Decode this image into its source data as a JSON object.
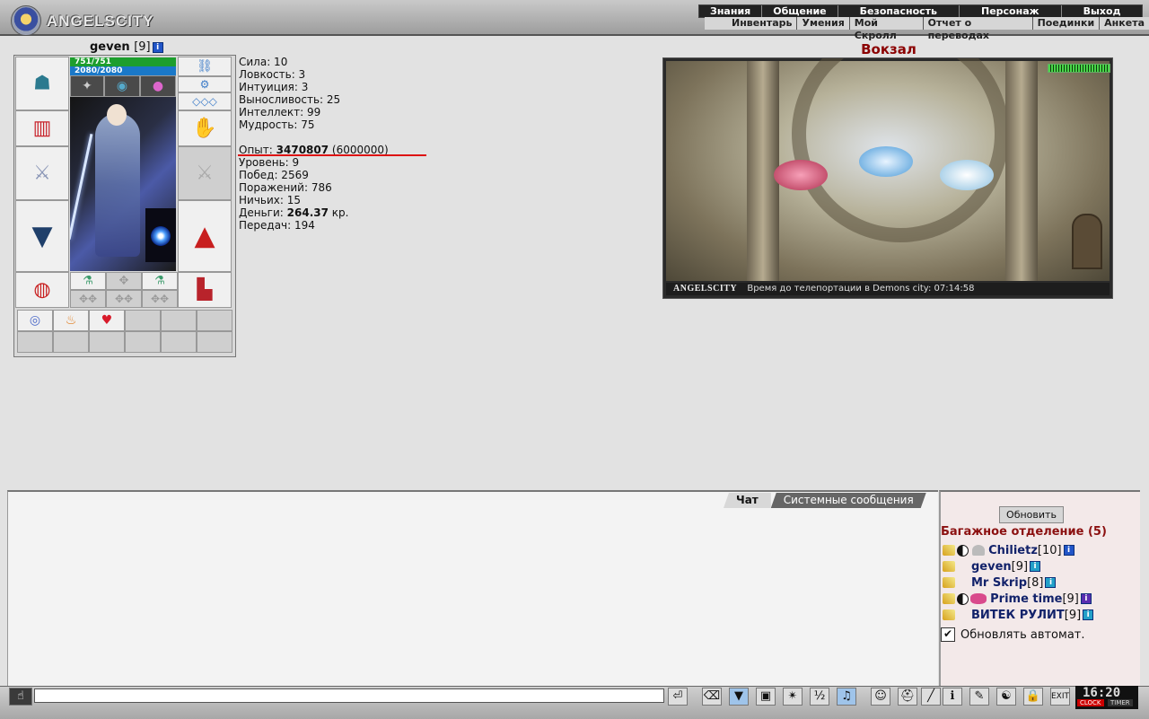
{
  "brand": "ANGELSCITY",
  "top_menu": [
    "Знания",
    "Общение",
    "Безопасность",
    "Персонаж",
    "Выход"
  ],
  "sub_menu": [
    "Инвентарь",
    "Умения",
    "Мой Скролл",
    "Отчет о переводах",
    "Поединки",
    "Анкета"
  ],
  "player": {
    "name": "geven",
    "level": "[9]",
    "hp": "751/751",
    "mp": "2080/2080",
    "hp_fraction": 1.0,
    "mp_fraction": 1.0
  },
  "stats": {
    "strength": "Сила: 10",
    "agility": "Ловкость: 3",
    "intuition": "Интуиция: 3",
    "endurance": "Выносливость: 25",
    "intellect": "Интеллект: 99",
    "wisdom": "Мудрость: 75"
  },
  "experience": {
    "label": "Опыт:",
    "value": "3470807",
    "next": "(6000000)"
  },
  "record": {
    "level": "Уровень: 9",
    "wins": "Побед: 2569",
    "losses": "Поражений: 786",
    "draws": "Ничьих: 15",
    "money_label": "Деньги:",
    "money_value": "264.37",
    "money_unit": "кр.",
    "transfers": "Передач: 194"
  },
  "location": {
    "title": "Вокзал",
    "scene_brand": "ANGELSCITY",
    "status": "Время до телепортации в Demons city: 07:14:58"
  },
  "chat_tabs": [
    "Чат",
    "Системные сообщения"
  ],
  "right_panel": {
    "refresh": "Обновить",
    "room": "Багажное отделение (5)",
    "users": [
      {
        "name": "Chilietz",
        "level": "[10]",
        "info_color": "#2155c8"
      },
      {
        "name": "geven",
        "level": "[9]",
        "info_color": "#22a0c8"
      },
      {
        "name": "Mr Skrip",
        "level": "[8]",
        "info_color": "#22a0c8"
      },
      {
        "name": "Prime time",
        "level": "[9]",
        "info_color": "#5a2db0"
      },
      {
        "name": "ВИТЕК РУЛИТ",
        "level": "[9]",
        "info_color": "#22a0c8"
      }
    ],
    "auto_refresh": "Обновлять автомат."
  },
  "clock": {
    "time": "16:20",
    "label1": "CLOCK",
    "label2": "TIMER"
  },
  "toolbar_icons": [
    "send-icon",
    "eraser-icon",
    "filter-icon",
    "save-icon",
    "fight-icon",
    "fraction-icon",
    "music-icon",
    "smile-icon",
    "helmet-icon",
    "slash-icon",
    "info-icon",
    "scroll-icon",
    "mask-icon",
    "lock-icon",
    "exit-icon"
  ]
}
